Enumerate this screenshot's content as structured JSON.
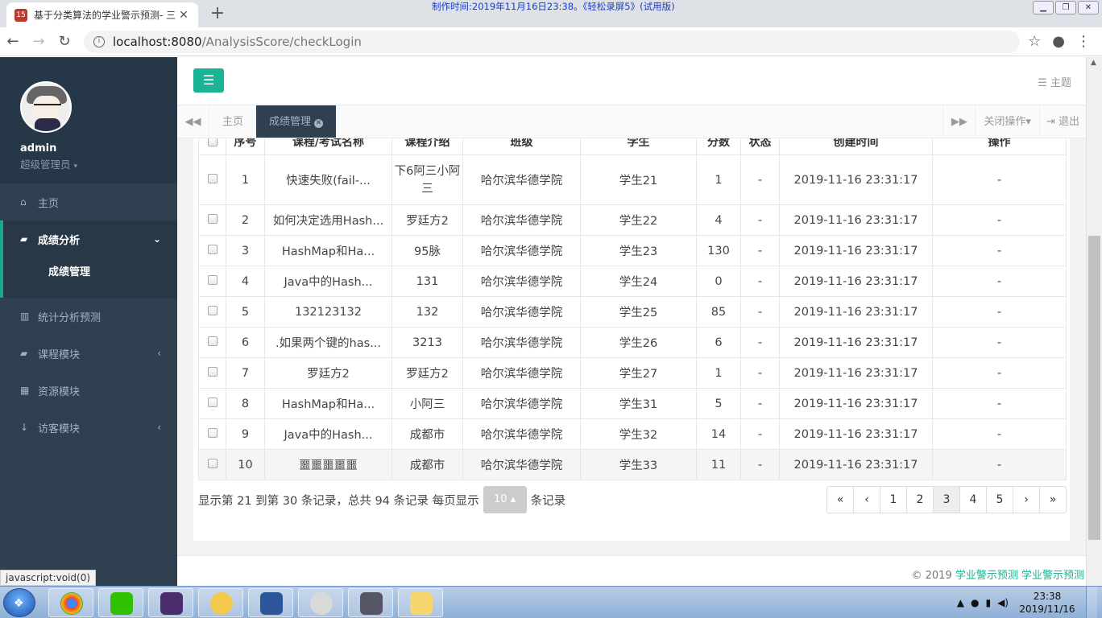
{
  "browser": {
    "tab_title": "基于分类算法的学业警示预测- 三",
    "favicon_text": "15",
    "url_host": "localhost:8080",
    "url_path": "/AnalysisScore/checkLogin",
    "recorder_note": "制作时间:2019年11月16日23:38。《轻松录屏5》(试用版)"
  },
  "sidebar": {
    "username": "admin",
    "role": "超级管理员",
    "items": [
      {
        "icon": "home-icon",
        "glyph": "⌂",
        "label": "主页",
        "active": false
      },
      {
        "icon": "book-icon",
        "glyph": "▰",
        "label": "成绩分析",
        "active": true,
        "expanded": true
      },
      {
        "label": "成绩管理",
        "sub": true
      },
      {
        "icon": "bar-chart-icon",
        "glyph": "▥",
        "label": "统计分析预测",
        "active": false
      },
      {
        "icon": "book-icon",
        "glyph": "▰",
        "label": "课程模块",
        "active": false,
        "has_children": true
      },
      {
        "icon": "table-icon",
        "glyph": "▦",
        "label": "资源模块",
        "active": false
      },
      {
        "icon": "download-icon",
        "glyph": "↓",
        "label": "访客模块",
        "active": false,
        "has_children": true
      }
    ]
  },
  "header": {
    "theme_label": "主题"
  },
  "pagetabs": {
    "home": "主页",
    "current": "成绩管理",
    "close_ops": "关闭操作",
    "logout": "退出"
  },
  "table": {
    "headers": [
      "",
      "序号",
      "课程/考试名称",
      "课程介绍",
      "班级",
      "学生",
      "分数",
      "状态",
      "创建时间",
      "操作"
    ],
    "rows": [
      {
        "no": "1",
        "name": "快速失败(fail-...",
        "intro": "下6阿三小阿三",
        "cls": "哈尔滨华德学院",
        "student": "学生21",
        "score": "1",
        "status": "-",
        "time": "2019-11-16 23:31:17",
        "op": "-"
      },
      {
        "no": "2",
        "name": "如何决定选用Hash...",
        "intro": "罗廷方2",
        "cls": "哈尔滨华德学院",
        "student": "学生22",
        "score": "4",
        "status": "-",
        "time": "2019-11-16 23:31:17",
        "op": "-"
      },
      {
        "no": "3",
        "name": "HashMap和Ha...",
        "intro": "95脉",
        "cls": "哈尔滨华德学院",
        "student": "学生23",
        "score": "130",
        "status": "-",
        "time": "2019-11-16 23:31:17",
        "op": "-"
      },
      {
        "no": "4",
        "name": "Java中的Hash...",
        "intro": "131",
        "cls": "哈尔滨华德学院",
        "student": "学生24",
        "score": "0",
        "status": "-",
        "time": "2019-11-16 23:31:17",
        "op": "-"
      },
      {
        "no": "5",
        "name": "132123132",
        "intro": "132",
        "cls": "哈尔滨华德学院",
        "student": "学生25",
        "score": "85",
        "status": "-",
        "time": "2019-11-16 23:31:17",
        "op": "-"
      },
      {
        "no": "6",
        "name": ".如果两个键的has...",
        "intro": "3213",
        "cls": "哈尔滨华德学院",
        "student": "学生26",
        "score": "6",
        "status": "-",
        "time": "2019-11-16 23:31:17",
        "op": "-"
      },
      {
        "no": "7",
        "name": "罗廷方2",
        "intro": "罗廷方2",
        "cls": "哈尔滨华德学院",
        "student": "学生27",
        "score": "1",
        "status": "-",
        "time": "2019-11-16 23:31:17",
        "op": "-"
      },
      {
        "no": "8",
        "name": "HashMap和Ha...",
        "intro": "小阿三",
        "cls": "哈尔滨华德学院",
        "student": "学生31",
        "score": "5",
        "status": "-",
        "time": "2019-11-16 23:31:17",
        "op": "-"
      },
      {
        "no": "9",
        "name": "Java中的Hash...",
        "intro": "成都市",
        "cls": "哈尔滨华德学院",
        "student": "学生32",
        "score": "14",
        "status": "-",
        "time": "2019-11-16 23:31:17",
        "op": "-"
      },
      {
        "no": "10",
        "name": "噩噩噩噩噩",
        "intro": "成都市",
        "cls": "哈尔滨华德学院",
        "student": "学生33",
        "score": "11",
        "status": "-",
        "time": "2019-11-16 23:31:17",
        "op": "-"
      }
    ]
  },
  "pagination": {
    "summary": "显示第 21 到第 30 条记录，总共 94 条记录 每页显示",
    "page_size": "10",
    "suffix": "条记录",
    "pages": [
      "«",
      "‹",
      "1",
      "2",
      "3",
      "4",
      "5",
      "›",
      "»"
    ],
    "current_page": "3"
  },
  "footer": {
    "copyright_prefix": "© 2019 ",
    "link": "学业警示预测 学业警示预测"
  },
  "status_hint": "javascript:void(0)",
  "taskbar": {
    "time": "23:38",
    "date": "2019/11/16"
  },
  "colors": {
    "accent": "#1ab394",
    "sidebar_bg": "#2f4050",
    "sidebar_text": "#a7b1c2"
  }
}
